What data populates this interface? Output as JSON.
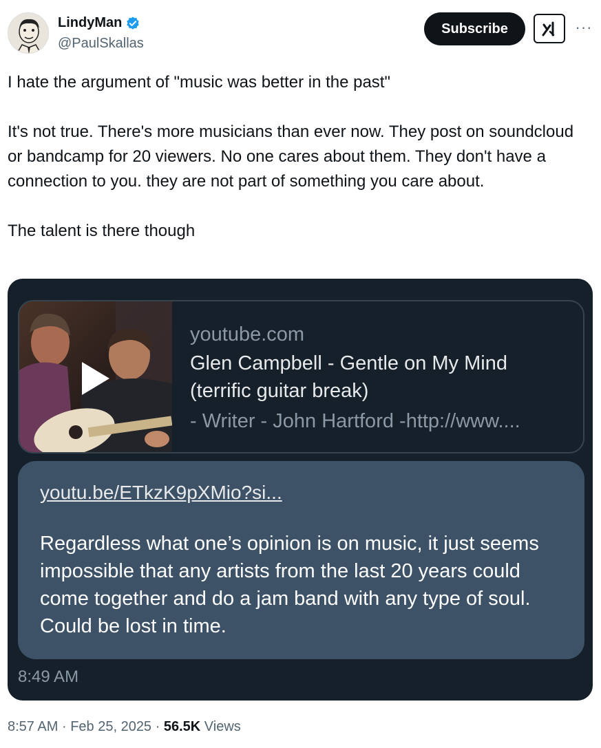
{
  "author": {
    "display_name": "LindyMan",
    "handle": "@PaulSkallas",
    "verified": true,
    "avatar_icon": "cartoon-man-avatar"
  },
  "actions": {
    "subscribe_label": "Subscribe",
    "grok_icon": "grok-icon",
    "more_label": "···"
  },
  "tweet": {
    "paragraphs": [
      "I hate the argument of \"music was better in the past\"",
      "It's not true. There's more musicians than ever now. They post on soundcloud or bandcamp for 20 viewers. No one cares about them. They don't have a connection to you. they are not part of something you care about.",
      "The talent is there though"
    ]
  },
  "embed": {
    "background_color": "#15202b",
    "preview": {
      "domain": "youtube.com",
      "title": "Glen Campbell - Gentle on My Mind (terrific guitar break)",
      "description": "- Writer - John Hartford -http://www....",
      "thumbnail_icon": "play-icon"
    },
    "message": {
      "link": "youtu.be/ETkzK9pXMio?si...",
      "text": "Regardless what one’s opinion is on music, it just seems impossible that any artists from the last 20 years could come together and do a jam band with any type of soul. Could be lost in time.",
      "bubble_color": "#3d5266"
    },
    "timestamp": "8:49 AM"
  },
  "footer": {
    "time": "8:57 AM",
    "separator": "·",
    "date": "Feb 25, 2025",
    "views_count": "56.5K",
    "views_label": "Views"
  },
  "colors": {
    "verified_badge": "#1d9bf0",
    "text_primary": "#0f1419",
    "text_secondary": "#536471"
  }
}
